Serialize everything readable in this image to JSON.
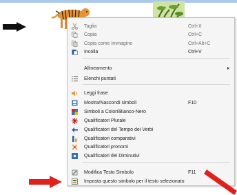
{
  "menu": {
    "items": [
      {
        "label": "Taglia",
        "shortcut": "Ctrl+X",
        "icon": "scissors-icon",
        "disabled": true
      },
      {
        "label": "Copia",
        "shortcut": "Ctrl+C",
        "icon": "copy-icon",
        "disabled": true
      },
      {
        "label": "Copia come Immagine",
        "shortcut": "Ctrl+Alt+C",
        "icon": "copy-image-icon",
        "disabled": true
      },
      {
        "label": "Incolla",
        "shortcut": "Ctrl+V",
        "icon": "paste-icon",
        "disabled": false
      },
      {
        "label": "Allineamento",
        "shortcut": "",
        "icon": "",
        "disabled": false,
        "submenu": true
      },
      {
        "label": "Elenchi puntati",
        "shortcut": "",
        "icon": "bullet-list-icon",
        "disabled": false
      },
      {
        "label": "Leggi frase",
        "shortcut": "",
        "icon": "speaker-icon",
        "disabled": false
      },
      {
        "label": "Mostra/Nascondi simboli",
        "shortcut": "F10",
        "icon": "show-hide-symbols-icon",
        "disabled": false
      },
      {
        "label": "Simboli a Colori/Bianco-Nero",
        "shortcut": "",
        "icon": "color-symbols-icon",
        "disabled": false
      },
      {
        "label": "Qualificatori Plurale",
        "shortcut": "",
        "icon": "plural-icon",
        "disabled": false
      },
      {
        "label": "Qualificatori del Tempo dei Verbi",
        "shortcut": "",
        "icon": "verb-tense-icon",
        "disabled": false
      },
      {
        "label": "Qualificatori comparativi",
        "shortcut": "",
        "icon": "comparative-icon",
        "disabled": false
      },
      {
        "label": "Qualificatori pronomi",
        "shortcut": "",
        "icon": "pronoun-icon",
        "disabled": false
      },
      {
        "label": "Qualificatori dei Diminutivi",
        "shortcut": "",
        "icon": "diminutive-icon",
        "disabled": false
      },
      {
        "label": "Modifica Testo Simbolo",
        "shortcut": "F11",
        "icon": "edit-symbol-text-icon",
        "disabled": false
      },
      {
        "label": "Imposta questo simbolo per il testo selezionato",
        "shortcut": "",
        "icon": "set-symbol-icon",
        "disabled": false
      }
    ]
  },
  "colors": {
    "accent_red": "#e0201b",
    "menu_bg": "#f5f5f5",
    "top_band": "#a9c8ea"
  }
}
